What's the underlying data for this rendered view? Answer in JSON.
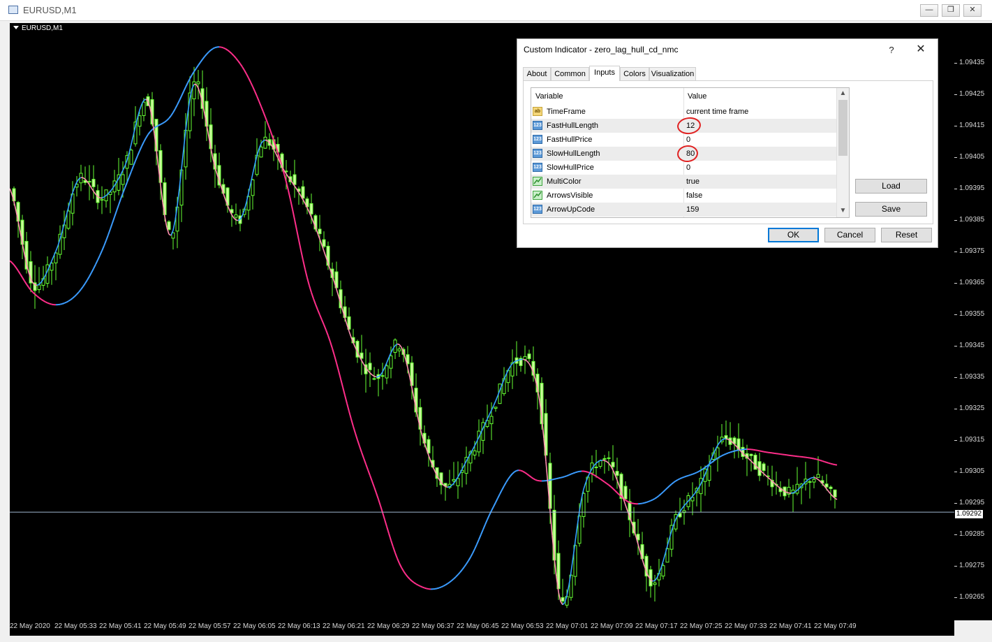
{
  "window": {
    "title": "EURUSD,M1",
    "buttons": {
      "minimize": "—",
      "restore": "❐",
      "close": "✕"
    }
  },
  "chart": {
    "symbol_label": "EURUSD,M1",
    "bid_price": "1.09292",
    "price_ticks": [
      "1.09435",
      "1.09425",
      "1.09415",
      "1.09405",
      "1.09395",
      "1.09385",
      "1.09375",
      "1.09365",
      "1.09355",
      "1.09345",
      "1.09335",
      "1.09325",
      "1.09315",
      "1.09305",
      "1.09295",
      "1.09285",
      "1.09275",
      "1.09265"
    ],
    "time_ticks": [
      "22 May 2020",
      "22 May 05:33",
      "22 May 05:41",
      "22 May 05:49",
      "22 May 05:57",
      "22 May 06:05",
      "22 May 06:13",
      "22 May 06:21",
      "22 May 06:29",
      "22 May 06:37",
      "22 May 06:45",
      "22 May 06:53",
      "22 May 07:01",
      "22 May 07:09",
      "22 May 07:17",
      "22 May 07:25",
      "22 May 07:33",
      "22 May 07:41",
      "22 May 07:49"
    ],
    "colors": {
      "background": "#000000",
      "candle": "#66ff33",
      "candle_body": "#c8ff9a",
      "fast_up": "#33a3ff",
      "fast_down": "#ff8fb0",
      "slow_up": "#3b9cff",
      "slow_down": "#ff2e8a",
      "bid_line": "#a0b8d0"
    }
  },
  "chart_data": {
    "type": "line",
    "title": "",
    "xlabel": "",
    "ylabel": "",
    "ylim": [
      1.09262,
      1.09441
    ],
    "x": [
      "05:25",
      "05:29",
      "05:33",
      "05:37",
      "05:41",
      "05:45",
      "05:49",
      "05:53",
      "05:57",
      "06:01",
      "06:05",
      "06:09",
      "06:13",
      "06:17",
      "06:21",
      "06:25",
      "06:29",
      "06:33",
      "06:37",
      "06:41",
      "06:45",
      "06:49",
      "06:53",
      "06:57",
      "07:01",
      "07:05",
      "07:09",
      "07:13",
      "07:17",
      "07:21",
      "07:25",
      "07:29",
      "07:33",
      "07:37",
      "07:41",
      "07:45",
      "07:49"
    ],
    "series": [
      {
        "values": [
          1.09395,
          1.09365,
          1.09375,
          1.09398,
          1.09392,
          1.09402,
          1.09423,
          1.0938,
          1.09428,
          1.094,
          1.09385,
          1.0941,
          1.094,
          1.09388,
          1.09368,
          1.09345,
          1.09335,
          1.09345,
          1.09315,
          1.093,
          1.0931,
          1.09325,
          1.0934,
          1.0933,
          1.09263,
          1.093,
          1.09308,
          1.0929,
          1.0927,
          1.0929,
          1.093,
          1.09315,
          1.0931,
          1.09303,
          1.09298,
          1.09303,
          1.09296
        ]
      },
      {
        "values": [
          1.09372,
          1.09362,
          1.09358,
          1.09362,
          1.09375,
          1.09395,
          1.09412,
          1.09418,
          1.09432,
          1.0944,
          1.09435,
          1.0942,
          1.09398,
          1.09365,
          1.09345,
          1.09318,
          1.09297,
          1.09275,
          1.09268,
          1.09269,
          1.09277,
          1.09293,
          1.09305,
          1.09302,
          1.09303,
          1.09305,
          1.09301,
          1.09295,
          1.09296,
          1.09302,
          1.09305,
          1.0931,
          1.09312,
          1.09311,
          1.0931,
          1.09309,
          1.09307
        ]
      }
    ]
  },
  "dialog": {
    "title": "Custom Indicator - zero_lag_hull_cd_nmc",
    "help": "?",
    "close": "✕",
    "tabs": [
      {
        "label": "About"
      },
      {
        "label": "Common"
      },
      {
        "label": "Inputs"
      },
      {
        "label": "Colors"
      },
      {
        "label": "Visualization"
      }
    ],
    "columns": {
      "variable": "Variable",
      "value": "Value"
    },
    "rows": [
      {
        "icon": "ab",
        "name": "TimeFrame",
        "value": "current time frame"
      },
      {
        "icon": "123",
        "name": "FastHullLength",
        "value": "12"
      },
      {
        "icon": "123",
        "name": "FastHullPrice",
        "value": "0"
      },
      {
        "icon": "123",
        "name": "SlowHullLength",
        "value": "80"
      },
      {
        "icon": "123",
        "name": "SlowHullPrice",
        "value": "0"
      },
      {
        "icon": "",
        "name": "MultiColor",
        "value": "true"
      },
      {
        "icon": "",
        "name": "ArrowsVisible",
        "value": "false"
      },
      {
        "icon": "123",
        "name": "ArrowUpCode",
        "value": "159"
      }
    ],
    "side_buttons": {
      "load": "Load",
      "save": "Save"
    },
    "footer_buttons": {
      "ok": "OK",
      "cancel": "Cancel",
      "reset": "Reset"
    }
  }
}
